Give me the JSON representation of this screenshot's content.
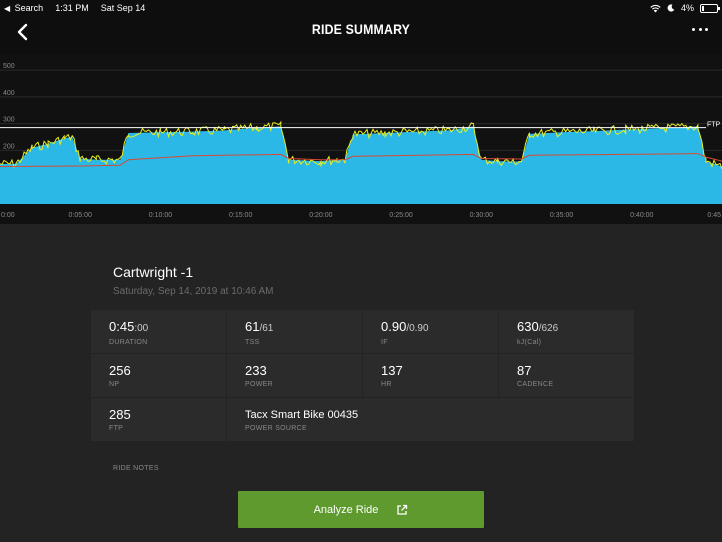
{
  "status": {
    "back_app": "Search",
    "time": "1:31 PM",
    "date": "Sat Sep 14",
    "battery": "4%",
    "icons": [
      "wifi-icon",
      "moon-icon",
      "battery-icon"
    ]
  },
  "nav": {
    "title": "RIDE SUMMARY",
    "back_icon": "chevron-left-icon",
    "more_icon": "more-horizontal-icon"
  },
  "colors": {
    "power_fill": "#2bb8e6",
    "power_line": "#e8ef1f",
    "hr_line": "#d64a33",
    "ftp_line": "#ffffff",
    "button": "#5f9a2e"
  },
  "chart_data": {
    "type": "area",
    "series": [
      {
        "name": "",
        "x": [
          "0:00",
          "0:01",
          "0:02",
          "0:03",
          "0:04",
          "0:04:30",
          "0:05",
          "0:06",
          "0:07",
          "0:07:30",
          "0:08",
          "0:10",
          "0:12",
          "0:14",
          "0:16",
          "0:17:30",
          "0:18",
          "0:20",
          "0:21",
          "0:21:30",
          "0:22",
          "0:24",
          "0:26",
          "0:28",
          "0:29:30",
          "0:30",
          "0:31",
          "0:32",
          "0:32:30",
          "0:33",
          "0:35",
          "0:37",
          "0:39",
          "0:40",
          "0:42",
          "0:43:30",
          "0:44",
          "0:45"
        ],
        "values": [
          150,
          150,
          210,
          225,
          245,
          250,
          170,
          165,
          165,
          165,
          265,
          268,
          270,
          275,
          285,
          290,
          165,
          160,
          165,
          165,
          260,
          265,
          270,
          275,
          290,
          165,
          160,
          158,
          160,
          262,
          268,
          272,
          278,
          280,
          285,
          290,
          160,
          140
        ]
      },
      {
        "name": "",
        "x": [
          "0:00",
          "0:05",
          "0:07:30",
          "0:08",
          "0:12",
          "0:17:30",
          "0:18",
          "0:20",
          "0:21:30",
          "0:22",
          "0:29:30",
          "0:30",
          "0:32:30",
          "0:33",
          "0:40",
          "0:43:30",
          "0:44",
          "0:45"
        ],
        "values": [
          140,
          142,
          145,
          165,
          180,
          185,
          170,
          165,
          165,
          178,
          185,
          170,
          168,
          182,
          186,
          188,
          175,
          160
        ]
      }
    ],
    "ftp": 285,
    "ftp_label": "FTP",
    "ylim": [
      0,
      560
    ],
    "yticks": [
      200,
      300,
      400,
      500
    ],
    "ytick_labels": [
      "200",
      "300",
      "400",
      "500"
    ],
    "xlim_min": [
      0,
      45
    ],
    "xticks": [
      "0:00",
      "0:05:00",
      "0:10:00",
      "0:15:00",
      "0:20:00",
      "0:25:00",
      "0:30:00",
      "0:35:00",
      "0:40:00",
      "0:45"
    ],
    "grid": true
  },
  "ride": {
    "name": "Cartwright -1",
    "date": "Saturday, Sep 14, 2019 at 10:46 AM"
  },
  "stats": [
    {
      "id": "duration",
      "value": "0:45",
      "sub": ":00",
      "label": "DURATION"
    },
    {
      "id": "tss",
      "value": "61",
      "sub": "/61",
      "label": "TSS"
    },
    {
      "id": "if",
      "value": "0.90",
      "sub": "/0.90",
      "label": "IF"
    },
    {
      "id": "kj",
      "value": "630",
      "sub": "/626",
      "label": "kJ(Cal)"
    },
    {
      "id": "np",
      "value": "256",
      "sub": "",
      "label": "NP"
    },
    {
      "id": "power",
      "value": "233",
      "sub": "",
      "label": "POWER"
    },
    {
      "id": "hr",
      "value": "137",
      "sub": "",
      "label": "HR"
    },
    {
      "id": "cadence",
      "value": "87",
      "sub": "",
      "label": "CADENCE"
    },
    {
      "id": "ftp",
      "value": "285",
      "sub": "",
      "label": "FTP"
    },
    {
      "id": "power_source",
      "value": "Tacx Smart Bike 00435",
      "sub": "",
      "label": "POWER SOURCE"
    }
  ],
  "ride_notes_label": "RIDE NOTES",
  "analyze_button": {
    "label": "Analyze Ride",
    "icon": "external-link-icon"
  }
}
